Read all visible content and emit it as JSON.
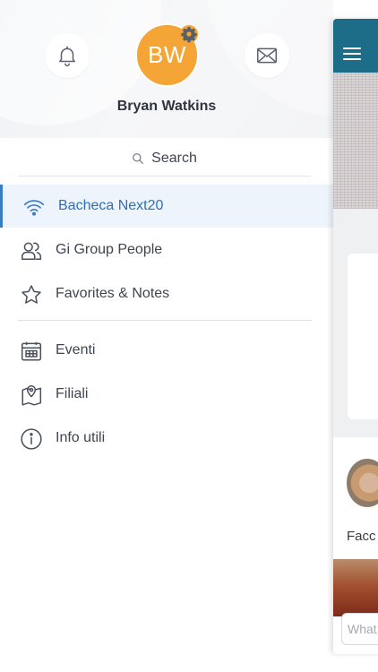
{
  "header": {
    "user_initials": "BW",
    "user_name": "Bryan Watkins",
    "notifications_icon": "bell-icon",
    "messages_icon": "envelope-icon",
    "settings_icon": "gear-icon",
    "avatar_color": "#f5a536"
  },
  "search": {
    "label": "Search",
    "icon": "search-icon"
  },
  "menu": {
    "primary": [
      {
        "label": "Bacheca Next20",
        "icon": "wifi-icon",
        "active": true
      },
      {
        "label": "Gi Group People",
        "icon": "people-icon",
        "active": false
      },
      {
        "label": "Favorites & Notes",
        "icon": "star-icon",
        "active": false
      }
    ],
    "secondary": [
      {
        "label": "Eventi",
        "icon": "calendar-icon"
      },
      {
        "label": "Filiali",
        "icon": "map-pin-icon"
      },
      {
        "label": "Info utili",
        "icon": "info-icon"
      }
    ]
  },
  "peek": {
    "menu_icon": "hamburger-icon",
    "post_text": "Facc",
    "comment_placeholder": "What",
    "bar_color": "#1e6d88"
  },
  "colors": {
    "accent": "#2f6fb5",
    "active_bg": "#eef4fb"
  }
}
